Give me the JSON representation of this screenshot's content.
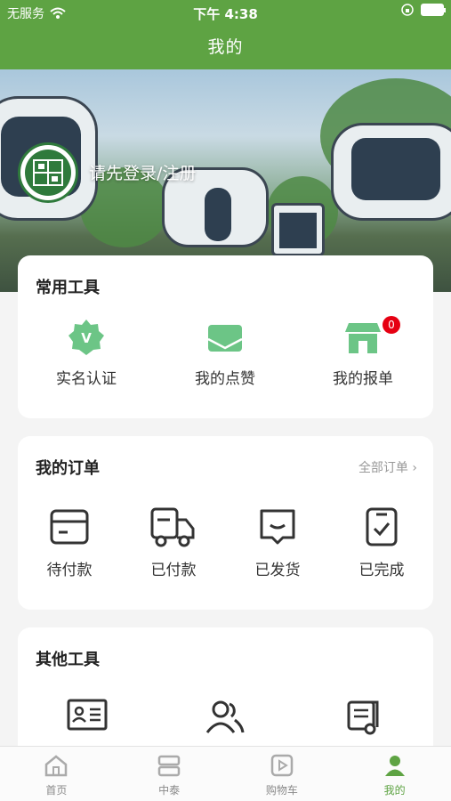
{
  "status_bar": {
    "carrier": "无服务",
    "time": "下午 4:38"
  },
  "header": {
    "title": "我的"
  },
  "profile": {
    "login_text": "请先登录/注册"
  },
  "common_tools": {
    "title": "常用工具",
    "items": [
      {
        "label": "实名认证",
        "icon": "verified-badge-icon"
      },
      {
        "label": "我的点赞",
        "icon": "envelope-icon"
      },
      {
        "label": "我的报单",
        "icon": "store-icon",
        "badge": "0"
      }
    ]
  },
  "orders": {
    "title": "我的订单",
    "all_orders": "全部订单 ›",
    "items": [
      {
        "label": "待付款",
        "icon": "card-icon"
      },
      {
        "label": "已付款",
        "icon": "truck-icon"
      },
      {
        "label": "已发货",
        "icon": "message-box-icon"
      },
      {
        "label": "已完成",
        "icon": "clipboard-check-icon"
      }
    ]
  },
  "other_tools": {
    "title": "其他工具",
    "items": [
      {
        "icon": "id-card-icon"
      },
      {
        "icon": "users-icon"
      },
      {
        "icon": "document-scroll-icon"
      }
    ]
  },
  "tabbar": {
    "items": [
      {
        "label": "首页",
        "icon": "home-icon"
      },
      {
        "label": "中泰",
        "icon": "layers-icon"
      },
      {
        "label": "购物车",
        "icon": "play-box-icon"
      },
      {
        "label": "我的",
        "icon": "person-icon",
        "active": true
      }
    ]
  },
  "colors": {
    "brand": "#5ea343",
    "badge": "#e60012",
    "icon_green": "#6cc586"
  }
}
